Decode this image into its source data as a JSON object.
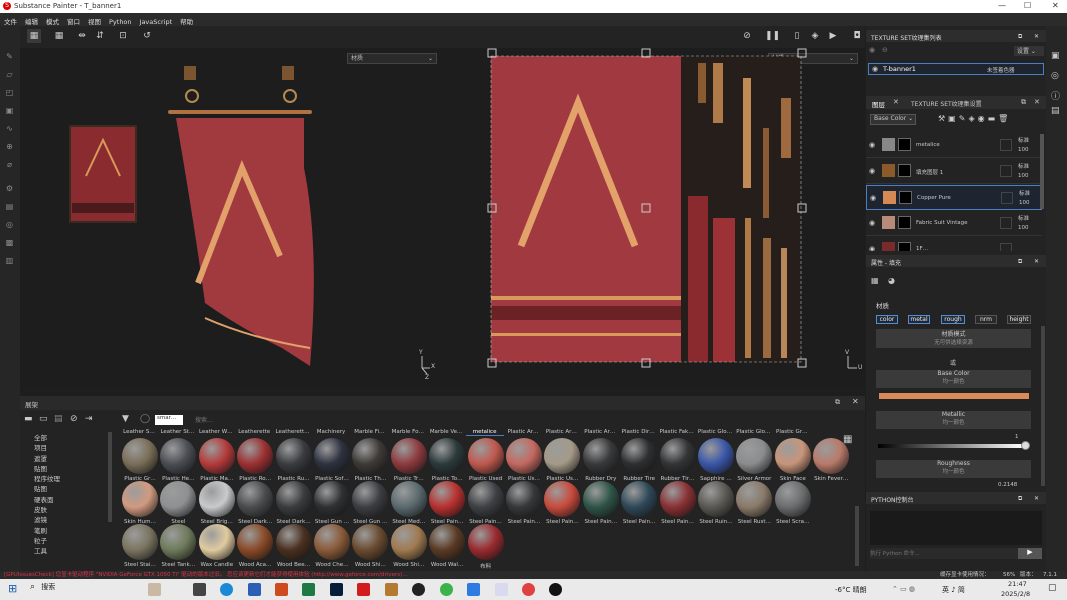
{
  "window": {
    "title": "Substance Painter - T_banner1",
    "minimize": "—",
    "maximize": "☐",
    "close": "✕"
  },
  "menu": [
    "文件",
    "编辑",
    "模式",
    "窗口",
    "视图",
    "Python",
    "JavaScript",
    "帮助"
  ],
  "viewport3d": {
    "material_select": "材质",
    "axes": {
      "y": "Y",
      "x": "X",
      "z": "Z"
    }
  },
  "viewport2d": {
    "material_select": "材质",
    "axes": {
      "v": "V",
      "u": "U"
    }
  },
  "shelf": {
    "title": "展架",
    "search_placeholder": "搜索...",
    "filter_tag": "smar…",
    "categories": [
      "全部",
      "项目",
      "遮罩",
      "贴图",
      "程序纹理",
      "贴图",
      "硬表面",
      "皮肤",
      "滤镜",
      "笔刷",
      "粒子",
      "工具"
    ],
    "header_row": [
      "Leather S…",
      "Leather St…",
      "Leather W…",
      "Leatherette",
      "Leatherett…",
      "Machinery",
      "Marble Fi…",
      "Marble Fo…",
      "Marble Ve…",
      "metalice",
      "Plastic Ar…",
      "Plastic Ar…",
      "Plastic Ar…",
      "Plastic Dir…",
      "Plastic Fak…",
      "Plastic Glo…",
      "Plastic Glo…",
      "Plastic Gr…"
    ],
    "rows": [
      [
        {
          "name": "Plastic Gr…",
          "color": "#7a6e58"
        },
        {
          "name": "Plastic He…",
          "color": "#4a4e54"
        },
        {
          "name": "Plastic Ma…",
          "color": "#b53a3a"
        },
        {
          "name": "Plastic Ro…",
          "color": "#9c3032"
        },
        {
          "name": "Plastic Ru…",
          "color": "#3a3c40"
        },
        {
          "name": "Plastic Sof…",
          "color": "#2e3240"
        },
        {
          "name": "Plastic Th…",
          "color": "#3d3a36"
        },
        {
          "name": "Plastic Tr…",
          "color": "#8e3a3e"
        },
        {
          "name": "Plastic To…",
          "color": "#2c3a3c"
        },
        {
          "name": "Plastic Used",
          "color": "#c0584e"
        },
        {
          "name": "Plastic Us…",
          "color": "#c46860"
        },
        {
          "name": "Plastic Us…",
          "color": "#a49a88"
        },
        {
          "name": "Rubber Dry",
          "color": "#38393b"
        },
        {
          "name": "Rubber Tire",
          "color": "#2e2f31"
        },
        {
          "name": "Rubber Tir…",
          "color": "#333436"
        },
        {
          "name": "Sapphire …",
          "color": "#3a56a8"
        },
        {
          "name": "Silver Armor",
          "color": "#8a8c8e"
        },
        {
          "name": "Skin Face",
          "color": "#c8957a"
        },
        {
          "name": "Skin Fever…",
          "color": "#b87a6a"
        }
      ],
      [
        {
          "name": "Skin Hum…",
          "color": "#d19a80"
        },
        {
          "name": "Steel",
          "color": "#8e9092"
        },
        {
          "name": "Steel Brig…",
          "color": "#c8cacc"
        },
        {
          "name": "Steel Dark…",
          "color": "#4a4c4e"
        },
        {
          "name": "Steel Dark…",
          "color": "#3a3c3e"
        },
        {
          "name": "Steel Gun …",
          "color": "#2e3032"
        },
        {
          "name": "Steel Gun …",
          "color": "#3c3e42"
        },
        {
          "name": "Steel Med…",
          "color": "#5a6a6e"
        },
        {
          "name": "Steel Pain…",
          "color": "#b8302e"
        },
        {
          "name": "Steel Pain…",
          "color": "#3e4044"
        },
        {
          "name": "Steel Pain…",
          "color": "#353739"
        },
        {
          "name": "Steel Pain…",
          "color": "#c84a3c"
        },
        {
          "name": "Steel Pain…",
          "color": "#2e5448"
        },
        {
          "name": "Steel Pain…",
          "color": "#2e4858"
        },
        {
          "name": "Steel Pain…",
          "color": "#8a3034"
        },
        {
          "name": "Steel Ruin…",
          "color": "#5a5852"
        },
        {
          "name": "Steel Rust…",
          "color": "#8a7a6a"
        },
        {
          "name": "Steel Scra…",
          "color": "#6a6c6e"
        }
      ],
      [
        {
          "name": "Steel Stai…",
          "color": "#7a7460"
        },
        {
          "name": "Steel Tank…",
          "color": "#6e7a5a"
        },
        {
          "name": "Wax Candle",
          "color": "#e0cba0"
        },
        {
          "name": "Wood Aca…",
          "color": "#8a4a28"
        },
        {
          "name": "Wood Bee…",
          "color": "#4a3020"
        },
        {
          "name": "Wood Che…",
          "color": "#8a5a38"
        },
        {
          "name": "Wood Shi…",
          "color": "#6a4a30"
        },
        {
          "name": "Wood Shi…",
          "color": "#a07a50"
        },
        {
          "name": "Wood Wal…",
          "color": "#5a3a24"
        },
        {
          "name": "布料",
          "color": "#9a2a2e"
        }
      ]
    ]
  },
  "right": {
    "texset_title": "TEXTURE SET纹理集列表",
    "settings": "设置",
    "texset_name": "T-banner1",
    "texset_shader": "未签着色器",
    "layers_tab": "图层",
    "texset_settings_tab": "TEXTURE SET纹理集设置",
    "channel": "Base Color",
    "layers": [
      {
        "name": "metalice",
        "blend": "标准",
        "opacity": "100"
      },
      {
        "name": "填充图层 1",
        "blend": "标准",
        "opacity": "100"
      },
      {
        "name": "Copper Pure",
        "blend": "标准",
        "opacity": "100"
      },
      {
        "name": "Fabric Suit Vintage",
        "blend": "标准",
        "opacity": "100"
      },
      {
        "name": "1F…",
        "blend": "",
        "opacity": ""
      }
    ],
    "props_title": "属性 - 填充",
    "material_label": "材质",
    "chips": [
      "color",
      "metal",
      "rough",
      "nrm",
      "height"
    ],
    "material_mode": "材质模式",
    "material_mode_sub": "无可供选择资源",
    "or": "或",
    "base_color": "Base Color",
    "base_color_sub": "均一颜色",
    "base_color_value": "#d9895a",
    "metallic": "Metallic",
    "metallic_sub": "均一颜色",
    "metallic_value": "1",
    "roughness": "Roughness",
    "roughness_sub": "均一颜色",
    "roughness_value": "0.2148",
    "console_title": "PYTHON控制台",
    "console_placeholder": "执行 Python 命令..."
  },
  "status": {
    "message": "[GPUIssuesCheck] 您显卡驱动程序 \"NVIDIA GeForce GTX 1050 Ti\" 驱动的版本过旧。 您应该更新它们才能获得使用体验 (http://www.geforce.com/drivers)…",
    "memory_label": "缓存显卡使用情况：",
    "memory_value": "56%",
    "version": "版本：",
    "version_value": "7.1.1"
  },
  "taskbar": {
    "search": "搜索",
    "weather": "-6°C 晴朗",
    "ime": "英 ♪ 简",
    "time": "21:47",
    "date": "2025/2/8"
  }
}
